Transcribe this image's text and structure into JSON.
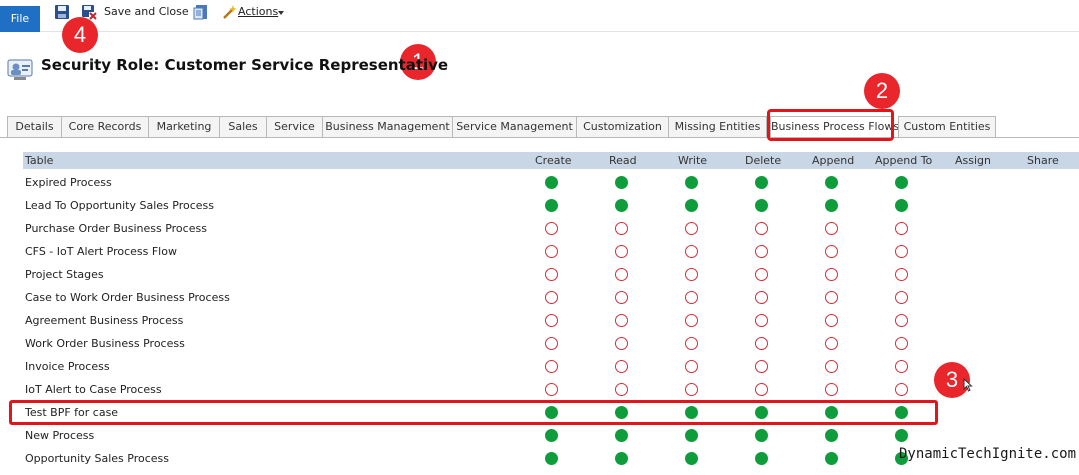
{
  "ribbon": {
    "file_label": "File",
    "save_close_label": "Save and Close",
    "actions_label": "Actions"
  },
  "page": {
    "title": "Security Role: Customer Service Representative"
  },
  "tabs": [
    {
      "label": "Details"
    },
    {
      "label": "Core Records"
    },
    {
      "label": "Marketing"
    },
    {
      "label": "Sales"
    },
    {
      "label": "Service"
    },
    {
      "label": "Business Management"
    },
    {
      "label": "Service Management"
    },
    {
      "label": "Customization"
    },
    {
      "label": "Missing Entities"
    },
    {
      "label": "Business Process Flows"
    },
    {
      "label": "Custom Entities"
    }
  ],
  "active_tab": "Business Process Flows",
  "grid": {
    "headers": [
      "Table",
      "Create",
      "Read",
      "Write",
      "Delete",
      "Append",
      "Append To",
      "Assign",
      "Share"
    ],
    "rows": [
      {
        "name": "Expired Process",
        "state": "filled"
      },
      {
        "name": "Lead To Opportunity Sales Process",
        "state": "filled"
      },
      {
        "name": "Purchase Order Business Process",
        "state": "empty"
      },
      {
        "name": "CFS - IoT Alert Process Flow",
        "state": "empty"
      },
      {
        "name": "Project Stages",
        "state": "empty"
      },
      {
        "name": "Case to Work Order Business Process",
        "state": "empty"
      },
      {
        "name": "Agreement Business Process",
        "state": "empty"
      },
      {
        "name": "Work Order Business Process",
        "state": "empty"
      },
      {
        "name": "Invoice Process",
        "state": "empty"
      },
      {
        "name": "IoT Alert to Case Process",
        "state": "empty"
      },
      {
        "name": "Test BPF for case",
        "state": "filled"
      },
      {
        "name": "New Process",
        "state": "filled"
      },
      {
        "name": "Opportunity Sales Process",
        "state": "filled"
      }
    ]
  },
  "callouts": [
    "1",
    "2",
    "3",
    "4"
  ],
  "watermark": "DynamicTechIgnite.com",
  "colors": {
    "file_button": "#1f6fc5",
    "grid_header": "#c8d6e6",
    "privilege_granted": "#0f9d3c",
    "privilege_none": "#d0303a",
    "highlight": "#e3151b"
  }
}
